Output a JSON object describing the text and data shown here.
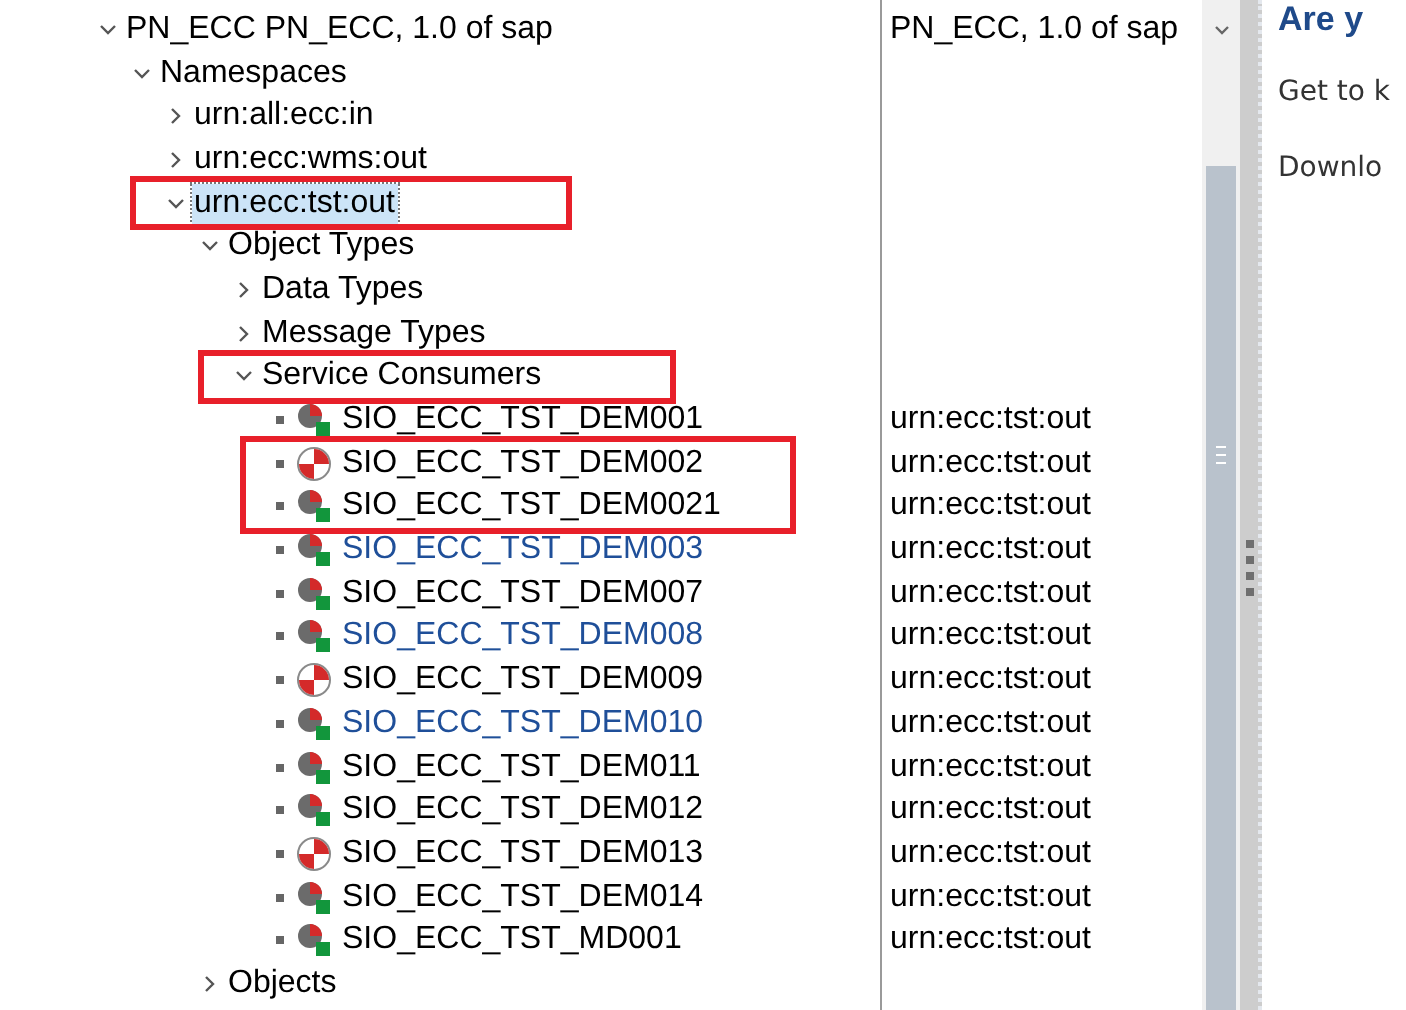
{
  "tree": [
    {
      "label": "PN_ECC PN_ECC, 1.0 of sap",
      "column_2": "PN_ECC, 1.0 of sap",
      "expanded": true,
      "selected": false,
      "marked": false,
      "children": [
        {
          "label": "Namespaces",
          "expanded": true,
          "selected": false,
          "marked": false,
          "children": [
            {
              "label": "urn:all:ecc:in",
              "expanded": false,
              "selected": false,
              "marked": false
            },
            {
              "label": "urn:ecc:wms:out",
              "expanded": false,
              "selected": false,
              "marked": false
            },
            {
              "label": "urn:ecc:tst:out",
              "expanded": true,
              "selected": true,
              "marked": true,
              "children": [
                {
                  "label": "Object Types",
                  "expanded": true,
                  "selected": false,
                  "marked": false,
                  "children": [
                    {
                      "label": "Data Types",
                      "expanded": false,
                      "selected": false,
                      "marked": false
                    },
                    {
                      "label": "Message Types",
                      "expanded": false,
                      "selected": false,
                      "marked": false
                    },
                    {
                      "label": "Service Consumers",
                      "expanded": true,
                      "selected": false,
                      "marked": true,
                      "children": [
                        {
                          "label": "SIO_ECC_TST_DEM001",
                          "kind": "pie",
                          "color": "#000000",
                          "column_2": "urn:ecc:tst:out",
                          "selected": false,
                          "marked": false
                        },
                        {
                          "label": "SIO_ECC_TST_DEM002",
                          "kind": "target",
                          "color": "#000000",
                          "column_2": "urn:ecc:tst:out",
                          "selected": false,
                          "marked": true
                        },
                        {
                          "label": "SIO_ECC_TST_DEM0021",
                          "kind": "pie",
                          "color": "#000000",
                          "column_2": "urn:ecc:tst:out",
                          "selected": false,
                          "marked": true
                        },
                        {
                          "label": "SIO_ECC_TST_DEM003",
                          "kind": "pie",
                          "color": "#1f4f99",
                          "column_2": "urn:ecc:tst:out",
                          "selected": false,
                          "marked": false
                        },
                        {
                          "label": "SIO_ECC_TST_DEM007",
                          "kind": "pie",
                          "color": "#000000",
                          "column_2": "urn:ecc:tst:out",
                          "selected": false,
                          "marked": false
                        },
                        {
                          "label": "SIO_ECC_TST_DEM008",
                          "kind": "pie",
                          "color": "#1f4f99",
                          "column_2": "urn:ecc:tst:out",
                          "selected": false,
                          "marked": false
                        },
                        {
                          "label": "SIO_ECC_TST_DEM009",
                          "kind": "target",
                          "color": "#000000",
                          "column_2": "urn:ecc:tst:out",
                          "selected": false,
                          "marked": false
                        },
                        {
                          "label": "SIO_ECC_TST_DEM010",
                          "kind": "pie",
                          "color": "#1f4f99",
                          "column_2": "urn:ecc:tst:out",
                          "selected": false,
                          "marked": false
                        },
                        {
                          "label": "SIO_ECC_TST_DEM011",
                          "kind": "pie",
                          "color": "#000000",
                          "column_2": "urn:ecc:tst:out",
                          "selected": false,
                          "marked": false
                        },
                        {
                          "label": "SIO_ECC_TST_DEM012",
                          "kind": "pie",
                          "color": "#000000",
                          "column_2": "urn:ecc:tst:out",
                          "selected": false,
                          "marked": false
                        },
                        {
                          "label": "SIO_ECC_TST_DEM013",
                          "kind": "target",
                          "color": "#000000",
                          "column_2": "urn:ecc:tst:out",
                          "selected": false,
                          "marked": false
                        },
                        {
                          "label": "SIO_ECC_TST_DEM014",
                          "kind": "pie",
                          "color": "#000000",
                          "column_2": "urn:ecc:tst:out",
                          "selected": false,
                          "marked": false
                        },
                        {
                          "label": "SIO_ECC_TST_MD001",
                          "kind": "pie",
                          "color": "#000000",
                          "column_2": "urn:ecc:tst:out",
                          "selected": false,
                          "marked": false
                        }
                      ]
                    }
                  ]
                },
                {
                  "label": "Objects",
                  "expanded": false,
                  "selected": false,
                  "marked": false
                }
              ]
            }
          ]
        }
      ]
    }
  ],
  "side_panel": {
    "heading": "Are y",
    "lines": [
      "Get to k",
      "Downlo"
    ]
  }
}
